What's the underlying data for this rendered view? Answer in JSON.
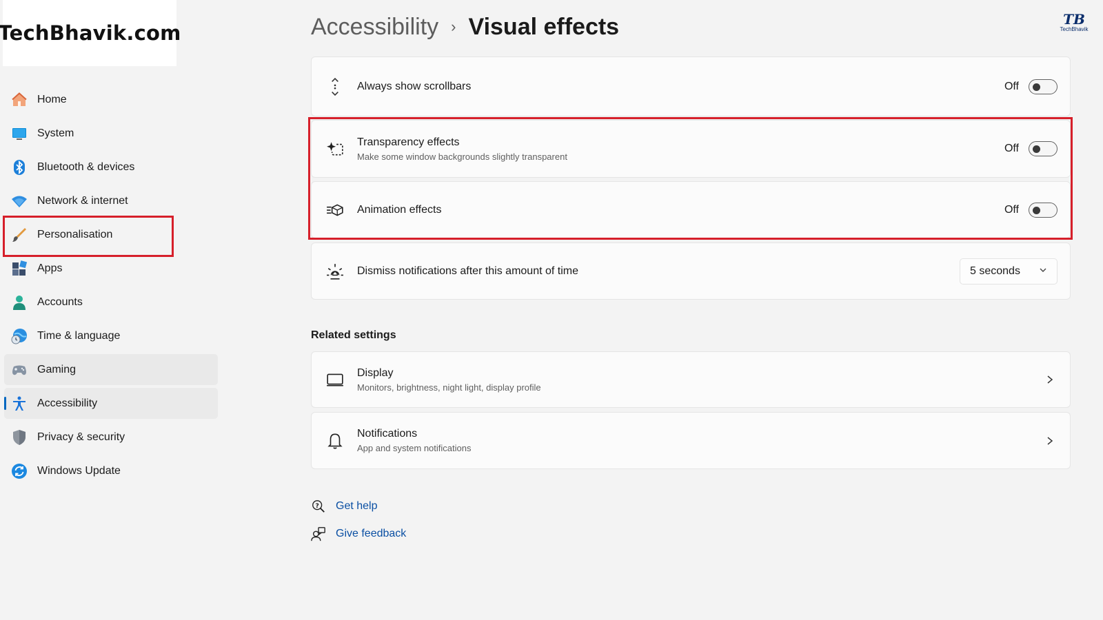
{
  "brand": {
    "site": "TechBhavik.com",
    "corner_logo_mark": "TB",
    "corner_logo_text": "TechBhavik"
  },
  "colors": {
    "accent": "#0067c0",
    "highlight": "#d61f2a",
    "link": "#0a4fa3"
  },
  "nav": {
    "items": [
      {
        "label": "Home",
        "icon": "home-icon"
      },
      {
        "label": "System",
        "icon": "system-icon"
      },
      {
        "label": "Bluetooth & devices",
        "icon": "bluetooth-icon"
      },
      {
        "label": "Network & internet",
        "icon": "wifi-icon"
      },
      {
        "label": "Personalisation",
        "icon": "brush-icon"
      },
      {
        "label": "Apps",
        "icon": "apps-icon"
      },
      {
        "label": "Accounts",
        "icon": "account-icon"
      },
      {
        "label": "Time & language",
        "icon": "globe-clock-icon"
      },
      {
        "label": "Gaming",
        "icon": "gamepad-icon"
      },
      {
        "label": "Accessibility",
        "icon": "accessibility-icon"
      },
      {
        "label": "Privacy & security",
        "icon": "shield-icon"
      },
      {
        "label": "Windows Update",
        "icon": "update-icon"
      }
    ],
    "selected": "Accessibility",
    "hovered": "Gaming",
    "highlighted": "Personalisation"
  },
  "breadcrumb": {
    "parent": "Accessibility",
    "separator": "›",
    "current": "Visual effects"
  },
  "settings": [
    {
      "title": "Always show scrollbars",
      "subtitle": "",
      "icon": "scrollbar-arrows-icon",
      "state": "Off"
    },
    {
      "title": "Transparency effects",
      "subtitle": "Make some window backgrounds slightly transparent",
      "icon": "transparency-icon",
      "state": "Off"
    },
    {
      "title": "Animation effects",
      "subtitle": "",
      "icon": "animation-icon",
      "state": "Off"
    },
    {
      "title": "Dismiss notifications after this amount of time",
      "subtitle": "",
      "icon": "brightness-icon",
      "value": "5 seconds"
    }
  ],
  "related": {
    "heading": "Related settings",
    "items": [
      {
        "title": "Display",
        "subtitle": "Monitors, brightness, night light, display profile",
        "icon": "monitor-icon"
      },
      {
        "title": "Notifications",
        "subtitle": "App and system notifications",
        "icon": "bell-icon"
      }
    ]
  },
  "links": {
    "get_help": "Get help",
    "give_feedback": "Give feedback"
  }
}
